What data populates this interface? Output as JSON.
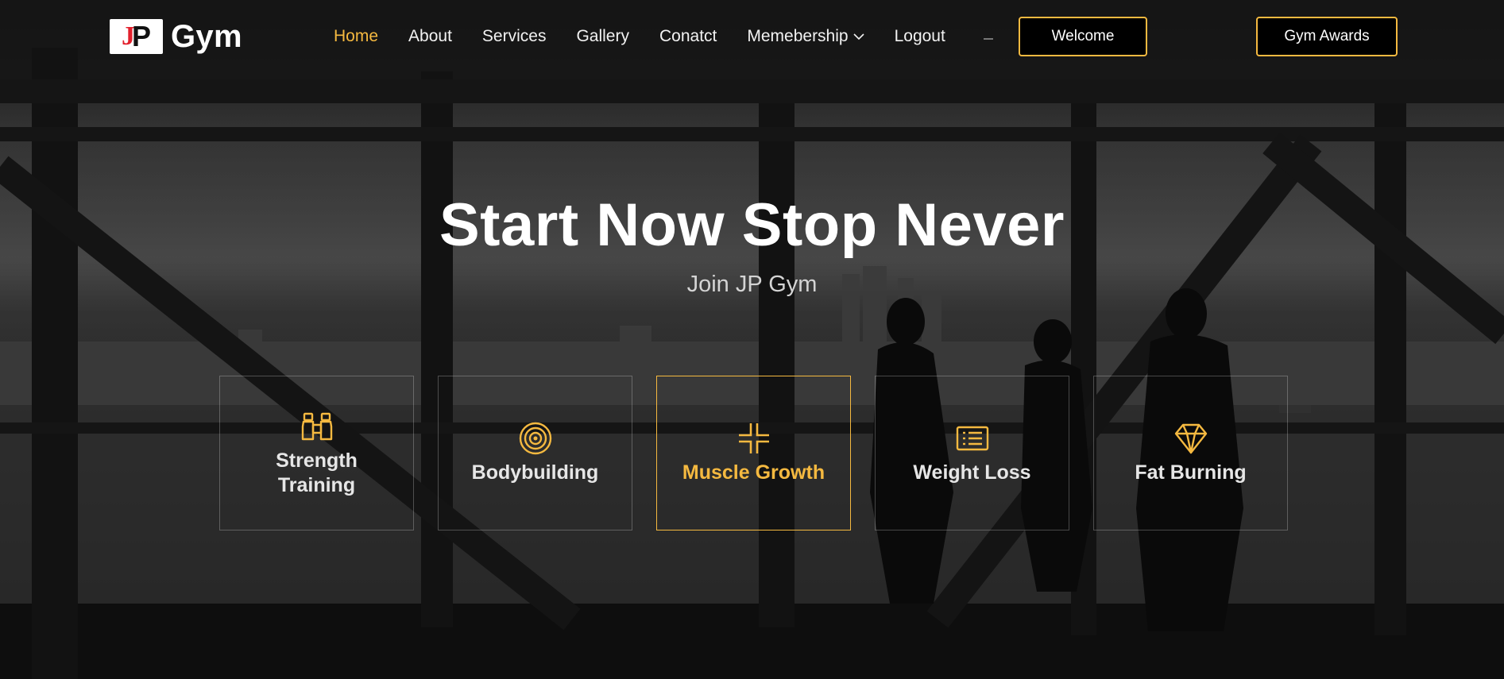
{
  "brand": {
    "logo_letters": "JP",
    "name": "Gym"
  },
  "nav": {
    "items": [
      {
        "label": "Home",
        "active": true
      },
      {
        "label": "About"
      },
      {
        "label": "Services"
      },
      {
        "label": "Gallery"
      },
      {
        "label": "Conatct"
      },
      {
        "label": "Memebership",
        "has_dropdown": true,
        "icon": "chevron-down-icon"
      },
      {
        "label": "Logout"
      }
    ]
  },
  "buttons": {
    "welcome": "Welcome",
    "awards": "Gym Awards"
  },
  "hero": {
    "title": "Start Now Stop Never",
    "subtitle": "Join JP Gym"
  },
  "features": [
    {
      "label": "Strength Training",
      "icon": "binoculars-icon"
    },
    {
      "label": "Bodybuilding",
      "icon": "target-icon"
    },
    {
      "label": "Muscle Growth",
      "icon": "collapse-icon",
      "active": true
    },
    {
      "label": "Weight Loss",
      "icon": "list-icon"
    },
    {
      "label": "Fat Burning",
      "icon": "diamond-icon"
    }
  ],
  "colors": {
    "accent": "#f5b940",
    "logo_red": "#e2202c",
    "background": "#1c1c1c"
  }
}
